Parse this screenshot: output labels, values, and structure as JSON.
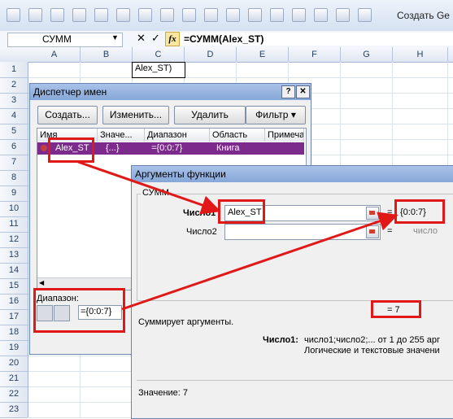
{
  "toolbar": {
    "create_label": "Создать Ge",
    "icons": [
      "grid-icon",
      "cut-icon",
      "paint-icon",
      "check-icon",
      "copy-icon",
      "paste-icon",
      "save-icon",
      "undo-icon",
      "redo-icon",
      "font-color-icon",
      "table-icon",
      "format-icon",
      "sort-icon",
      "filter-icon",
      "select-icon",
      "bucket-icon",
      "chart-icon"
    ]
  },
  "formula_bar": {
    "name_box": "СУММ",
    "cancel_glyph": "✕",
    "enter_glyph": "✓",
    "fx": "fx",
    "formula": "=СУММ(Alex_ST)"
  },
  "sheet": {
    "columns": [
      "A",
      "B",
      "C",
      "D",
      "E",
      "F",
      "G",
      "H"
    ],
    "rows": [
      "1",
      "2",
      "3",
      "4",
      "5",
      "6",
      "7",
      "8",
      "9",
      "10",
      "11",
      "12",
      "13",
      "14",
      "15",
      "16",
      "17",
      "18",
      "19",
      "20",
      "21",
      "22",
      "23"
    ],
    "cell_c1": "Alex_ST)"
  },
  "name_manager": {
    "title": "Диспетчер имен",
    "help": "?",
    "close": "✕",
    "buttons": {
      "create": "Создать...",
      "edit": "Изменить...",
      "delete": "Удалить",
      "filter": "Фильтр"
    },
    "columns": [
      "Имя",
      "Значе...",
      "Диапазон",
      "Область",
      "Примеча"
    ],
    "row": {
      "name": "Alex_ST",
      "value": "{...}",
      "range": "={0:0:7}",
      "scope": "Книга"
    },
    "range_label": "Диапазон:",
    "range_value": "={0:0:7}"
  },
  "function_args": {
    "title": "Аргументы функции",
    "group": "СУММ",
    "arg1_label": "Число1",
    "arg1_value": "Alex_ST",
    "arg1_eq": "=",
    "arg1_result": "{0:0:7}",
    "arg2_label": "Число2",
    "arg2_eq": "=",
    "arg2_result": "число",
    "result": "=  7",
    "description": "Суммирует аргументы.",
    "arg_name": "Число1:",
    "arg_desc_1": "число1;число2;... от 1 до 255 арг",
    "arg_desc_2": "Логические и текстовые значени",
    "value": "Значение:   7"
  }
}
